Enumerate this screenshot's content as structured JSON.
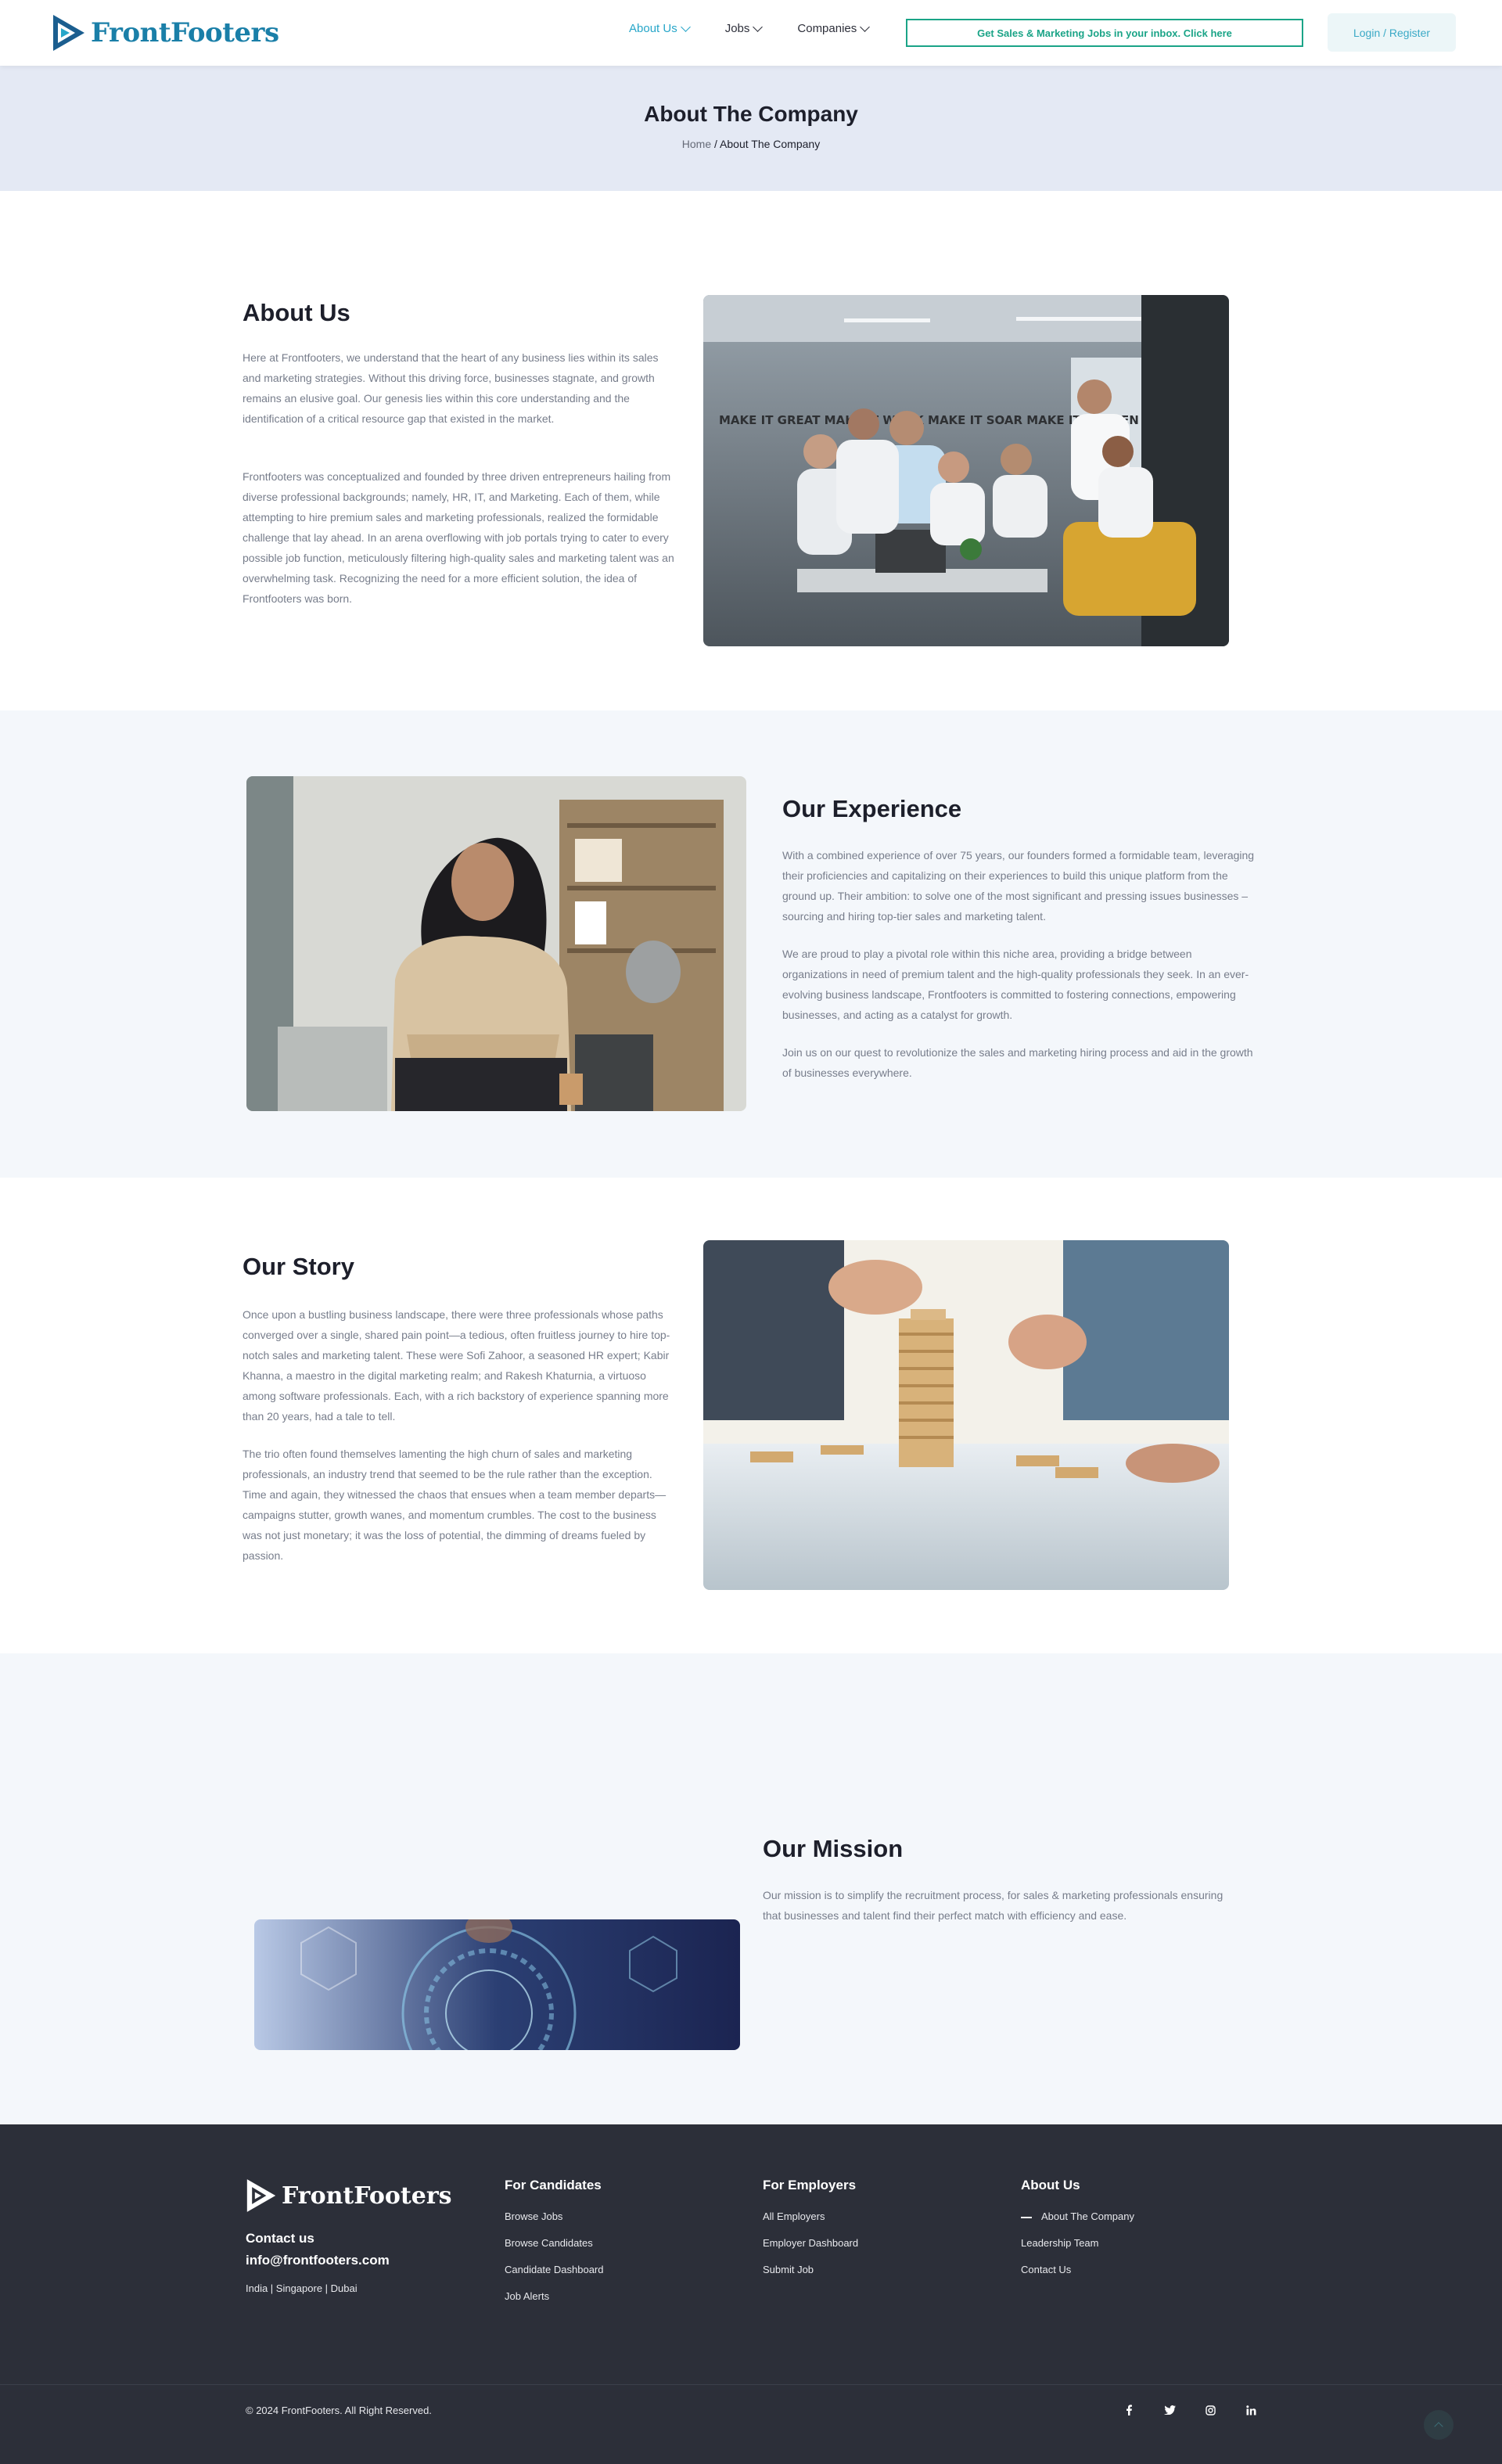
{
  "header": {
    "logo_text": "FrontFooters",
    "nav": [
      {
        "label": "About Us"
      },
      {
        "label": "Jobs"
      },
      {
        "label": "Companies"
      }
    ],
    "promo": "Get Sales & Marketing Jobs in your inbox. Click here",
    "login": "Login / Register"
  },
  "title_band": {
    "title": "About The Company",
    "breadcrumb_home": "Home",
    "breadcrumb_sep": "/",
    "breadcrumb_current": "About The Company"
  },
  "about": {
    "title": "About Us",
    "p1": "Here at Frontfooters, we understand that the heart of any business lies within its sales and marketing strategies. Without this driving force, businesses stagnate, and growth remains an elusive goal. Our genesis lies within this core understanding and the identification of a critical resource gap that existed in the market.",
    "p2": "Frontfooters was conceptualized and founded by three driven entrepreneurs hailing from diverse professional backgrounds; namely, HR, IT, and Marketing. Each of them, while attempting to hire premium sales and marketing professionals, realized the formidable challenge that lay ahead. In an arena overflowing with job portals trying to cater to every possible job function, meticulously filtering high-quality sales and marketing talent was an overwhelming task. Recognizing the need for a more efficient solution, the idea of Frontfooters was born.",
    "wall_text": "MAKE IT GREAT MAKE IT WORK MAKE IT SOAR MAKE IT HAPPEN"
  },
  "experience": {
    "title": "Our Experience",
    "p1": "With a combined experience of over 75 years, our founders formed a formidable team, leveraging their proficiencies and capitalizing on their experiences to build this unique platform from the ground up. Their ambition: to solve one of the most significant and pressing issues businesses – sourcing and hiring top-tier sales and marketing talent.",
    "p2": "We are proud to play a pivotal role within this niche area, providing a bridge between organizations in need of premium talent and the high-quality professionals they seek. In an ever-evolving business landscape, Frontfooters is committed to fostering connections, empowering businesses, and acting as a catalyst for growth.",
    "p3": "Join us on our quest to revolutionize the sales and marketing hiring process and aid in the growth of businesses everywhere."
  },
  "story": {
    "title": "Our Story",
    "p1": "Once upon a bustling business landscape, there were three professionals whose paths converged over a single, shared pain point—a tedious, often fruitless journey to hire top-notch sales and marketing talent. These were Sofi Zahoor, a seasoned HR expert; Kabir Khanna, a maestro in the digital marketing realm; and Rakesh Khaturnia, a virtuoso among software professionals. Each, with a rich backstory of experience spanning more than 20 years, had a tale to tell.",
    "p2": "The trio often found themselves lamenting the high churn of sales and marketing professionals, an industry trend that seemed to be the rule rather than the exception. Time and again, they witnessed the chaos that ensues when a team member departs—campaigns stutter, growth wanes, and momentum crumbles. The cost to the business was not just monetary; it was the loss of potential, the dimming of dreams fueled by passion."
  },
  "mission": {
    "title": "Our Mission",
    "p1": "Our mission is to simplify the recruitment process, for sales & marketing professionals ensuring that businesses and talent find their perfect match with efficiency and ease."
  },
  "footer": {
    "logo_text": "FrontFooters",
    "contact_label": "Contact us",
    "email": "info@frontfooters.com",
    "locations": "India | Singapore | Dubai",
    "candidates": {
      "title": "For Candidates",
      "links": [
        "Browse Jobs",
        "Browse Candidates",
        "Candidate Dashboard",
        "Job Alerts"
      ]
    },
    "employers": {
      "title": "For Employers",
      "links": [
        "All Employers",
        "Employer Dashboard",
        "Submit Job"
      ]
    },
    "about": {
      "title": "About Us",
      "links": [
        "About The Company",
        "Leadership Team",
        "Contact Us"
      ]
    },
    "copyright": "© 2024 FrontFooters. All Right Reserved.",
    "socials": [
      "f",
      "t",
      "ig",
      "in"
    ]
  },
  "colors": {
    "accent": "#27a6c9",
    "promo_green": "#1aa487",
    "title_band": "#e4e9f4",
    "alt_section": "#f4f7fb",
    "footer": "#2c2f39"
  }
}
